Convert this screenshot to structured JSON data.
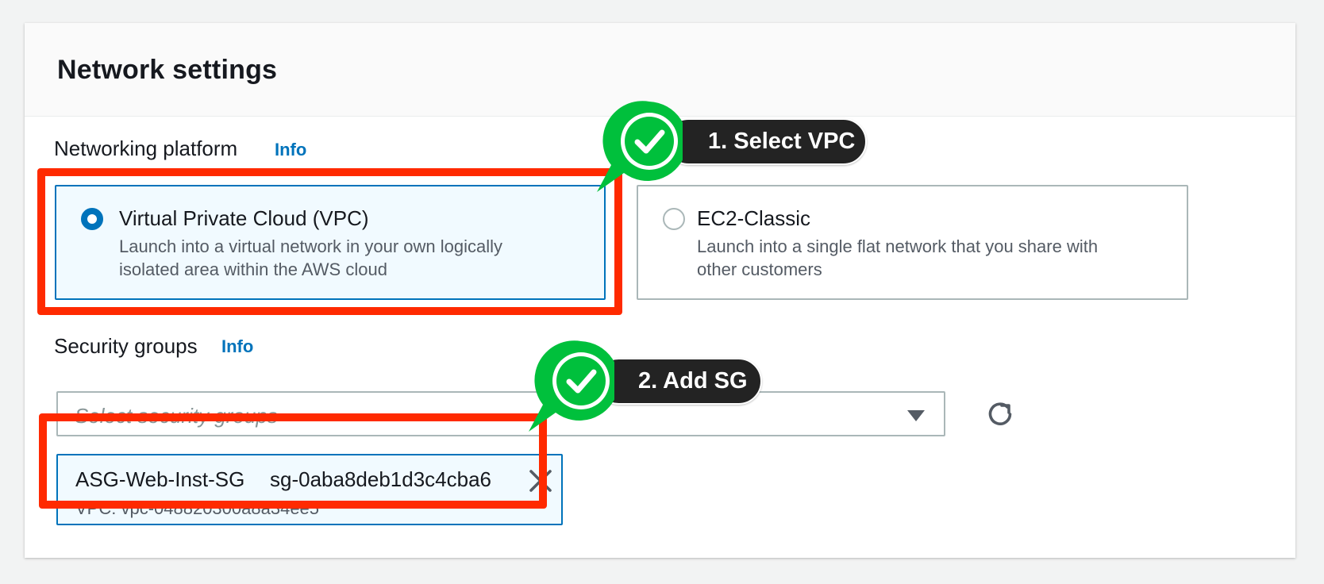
{
  "panel": {
    "title": "Network settings"
  },
  "networking_platform": {
    "label": "Networking platform",
    "info_label": "Info",
    "options": [
      {
        "title": "Virtual Private Cloud (VPC)",
        "description_lines": [
          "Launch into a virtual network in your own logically",
          "isolated area within the AWS cloud"
        ],
        "selected": true
      },
      {
        "title": "EC2-Classic",
        "description_lines": [
          "Launch into a single flat network that you share with",
          "other customers"
        ],
        "selected": false
      }
    ]
  },
  "security_groups": {
    "label": "Security groups",
    "info_label": "Info",
    "select_placeholder": "Select security groups",
    "selected_token": {
      "name": "ASG-Web-Inst-SG",
      "id": "sg-0aba8deb1d3c4cba6",
      "vpc": "VPC: vpc-048820300a8a34ee5"
    }
  },
  "annotations": [
    {
      "label": "1. Select VPC"
    },
    {
      "label": "2. Add SG"
    }
  ],
  "colors": {
    "accent": "#0073bb",
    "highlight": "#ff2a00",
    "check_badge": "#00c03c",
    "callout_bg": "#232323"
  },
  "icons": {
    "refresh": "refresh-icon",
    "dropdown": "caret-down-icon",
    "remove": "close-icon",
    "check": "checkmark-icon"
  }
}
